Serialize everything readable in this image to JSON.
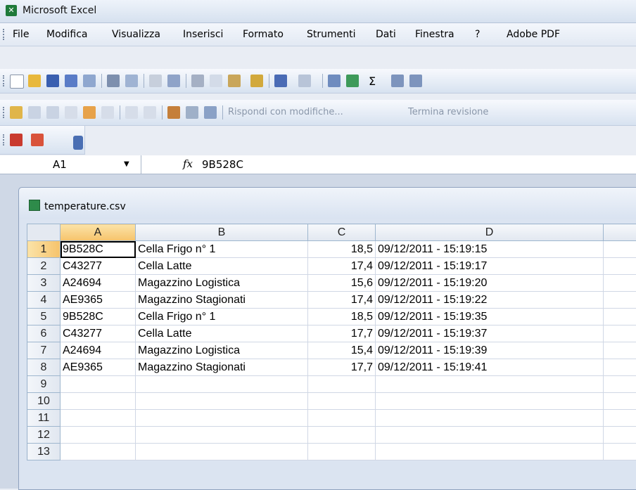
{
  "app": {
    "title": "Microsoft Excel",
    "icon": "excel-icon"
  },
  "menu": [
    "File",
    "Modifica",
    "Visualizza",
    "Inserisci",
    "Formato",
    "Strumenti",
    "Dati",
    "Finestra",
    "?",
    "Adobe PDF"
  ],
  "reviewing_toolbar": {
    "reply_label": "Rispondi con modifiche...",
    "end_label": "Termina revisione"
  },
  "formula_bar": {
    "name_box": "A1",
    "fx": "fx",
    "value": "9B528C"
  },
  "workbook": {
    "title": "temperature.csv"
  },
  "columns": [
    "A",
    "B",
    "C",
    "D",
    ""
  ],
  "rows": [
    {
      "n": "1",
      "a": "9B528C",
      "b": "Cella Frigo n° 1",
      "c": "18,5",
      "d": "09/12/2011 - 15:19:15"
    },
    {
      "n": "2",
      "a": "C43277",
      "b": "Cella Latte",
      "c": "17,4",
      "d": "09/12/2011 - 15:19:17"
    },
    {
      "n": "3",
      "a": "A24694",
      "b": "Magazzino Logistica",
      "c": "15,6",
      "d": "09/12/2011 - 15:19:20"
    },
    {
      "n": "4",
      "a": "AE9365",
      "b": "Magazzino Stagionati",
      "c": "17,4",
      "d": "09/12/2011 - 15:19:22"
    },
    {
      "n": "5",
      "a": "9B528C",
      "b": "Cella Frigo n° 1",
      "c": "18,5",
      "d": "09/12/2011 - 15:19:35"
    },
    {
      "n": "6",
      "a": "C43277",
      "b": "Cella Latte",
      "c": "17,7",
      "d": "09/12/2011 - 15:19:37"
    },
    {
      "n": "7",
      "a": "A24694",
      "b": "Magazzino Logistica",
      "c": "15,4",
      "d": "09/12/2011 - 15:19:39"
    },
    {
      "n": "8",
      "a": "AE9365",
      "b": "Magazzino Stagionati",
      "c": "17,7",
      "d": "09/12/2011 - 15:19:41"
    },
    {
      "n": "9",
      "a": "",
      "b": "",
      "c": "",
      "d": ""
    },
    {
      "n": "10",
      "a": "",
      "b": "",
      "c": "",
      "d": ""
    },
    {
      "n": "11",
      "a": "",
      "b": "",
      "c": "",
      "d": ""
    },
    {
      "n": "12",
      "a": "",
      "b": "",
      "c": "",
      "d": ""
    },
    {
      "n": "13",
      "a": "",
      "b": "",
      "c": "",
      "d": ""
    }
  ]
}
